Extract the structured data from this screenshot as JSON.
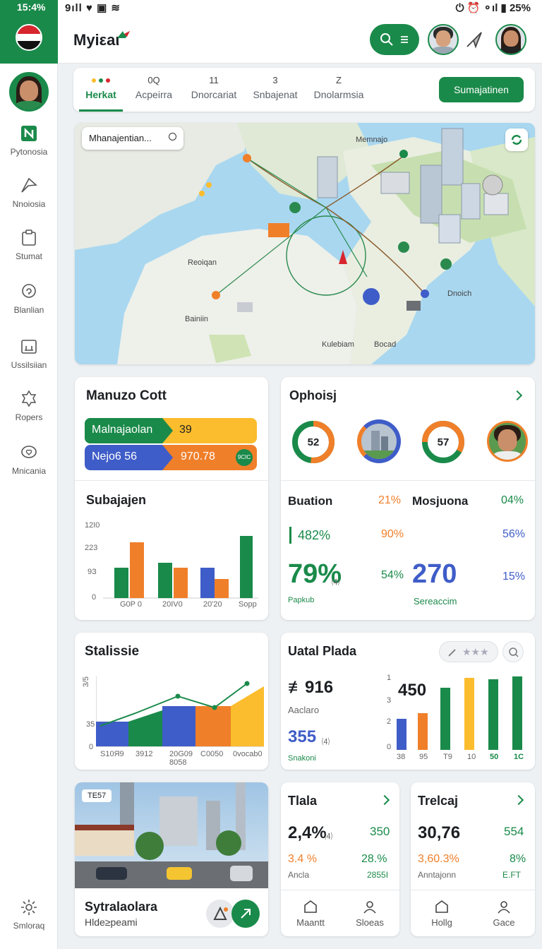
{
  "status_bar": {
    "time": "15:4%",
    "left_icons": "9ıll ♥ ▣ ≋",
    "right_icons": "⏻ ⏰ ⚬ıl ▮ 25%"
  },
  "app": {
    "title": "Myiεaι"
  },
  "sidebar": {
    "items": [
      {
        "label": "Pytonosia",
        "icon": "brand-square-icon"
      },
      {
        "label": "Nnoiosia",
        "icon": "send-icon"
      },
      {
        "label": "Stumat",
        "icon": "clipboard-icon"
      },
      {
        "label": "Blanlian",
        "icon": "info-circle-icon"
      },
      {
        "label": "Ussilsiian",
        "icon": "window-icon"
      },
      {
        "label": "Ropers",
        "icon": "badge-icon"
      },
      {
        "label": "Mnicania",
        "icon": "heart-bubble-icon"
      }
    ],
    "bottom": {
      "label": "Smloraq",
      "icon": "settings-icon"
    }
  },
  "tabs": [
    {
      "num": "",
      "label": "Herkat"
    },
    {
      "num": "0Q",
      "label": "Acpeirra"
    },
    {
      "num": "11",
      "label": "Dnorcariat"
    },
    {
      "num": "3",
      "label": "Snbajenat"
    },
    {
      "num": "Z",
      "label": "Dnolarmsia"
    }
  ],
  "tabs_button": "Sumajatinen",
  "map": {
    "search_text": "Mhanajentian...",
    "labels": [
      "Memnajo",
      "Reoiqan",
      "Bainiin",
      "Kulebiam",
      "Bocad",
      "Dnoich"
    ]
  },
  "card1": {
    "title": "Manuzo Cott",
    "bar1": {
      "label": "Malnajaolan",
      "value": "39"
    },
    "bar2": {
      "label": "Nejo6 56",
      "value": "970.78",
      "badge": "9CIC"
    },
    "sub_title": "Subajajen",
    "y_ticks": [
      "12I0",
      "223",
      "9З",
      "0"
    ],
    "x_labels": [
      "G0P 0",
      "20IV0",
      "20'20",
      "Sopp"
    ]
  },
  "card2": {
    "title": "Ophoisj",
    "donut1": "52",
    "donut2": "57",
    "col1_title": "Buation",
    "col1_pct": "21%",
    "col2_title": "Mosjuona",
    "col2_pct": "04%",
    "row1_left": "482%",
    "row1_mid": "90%",
    "row1_right": "56%",
    "big_left": "79%",
    "big_left_sub": "⑷",
    "big_left_caption": "Papkub",
    "mid_small": "54%",
    "big_right": "270",
    "big_right_caption": "Sereaccim",
    "right_small": "15%"
  },
  "card3": {
    "title": "Stalissie",
    "y_ticks": [
      "3/5",
      "35",
      "0"
    ],
    "x_labels": [
      "S10Я9",
      "3912",
      "20G09",
      "C0050",
      "0vocab0"
    ],
    "x_sub": "8058"
  },
  "card4": {
    "title": "Uatal Plada",
    "big1": "≢916",
    "big1_caption": "Aaclaro",
    "big2": "355",
    "big2_sub": "⑷",
    "big2_caption": "Snakoni",
    "right_big": "450",
    "y_ticks": [
      "1",
      "3",
      "2",
      "0"
    ],
    "x_labels": [
      "38",
      "95",
      "T9",
      "10",
      "50",
      "1C"
    ]
  },
  "card5": {
    "tag": "TE57",
    "title": "Sytralaolara",
    "subtitle": "Hlde≥peami"
  },
  "card6": {
    "title": "Tlala",
    "big": "2,4%",
    "big_sub": "⑷",
    "right": "350",
    "pct_left": "3.4 %",
    "pct_right": "28.%",
    "caption_left": "Ancla",
    "caption_right": "2855I",
    "foot1": "Maantt",
    "foot2": "Sloeas"
  },
  "card7": {
    "title": "Trelcaj",
    "big": "30,76",
    "right": "554",
    "pct_left": "3,60.3%",
    "pct_right": "8%",
    "caption_left": "Anntajonn",
    "caption_right": "E.FT",
    "foot1": "Hollg",
    "foot2": "Gace"
  },
  "colors": {
    "green": "#1a8a4a",
    "orange": "#f07f2a",
    "blue": "#3f5dc8",
    "yellow": "#fbbc2d"
  }
}
